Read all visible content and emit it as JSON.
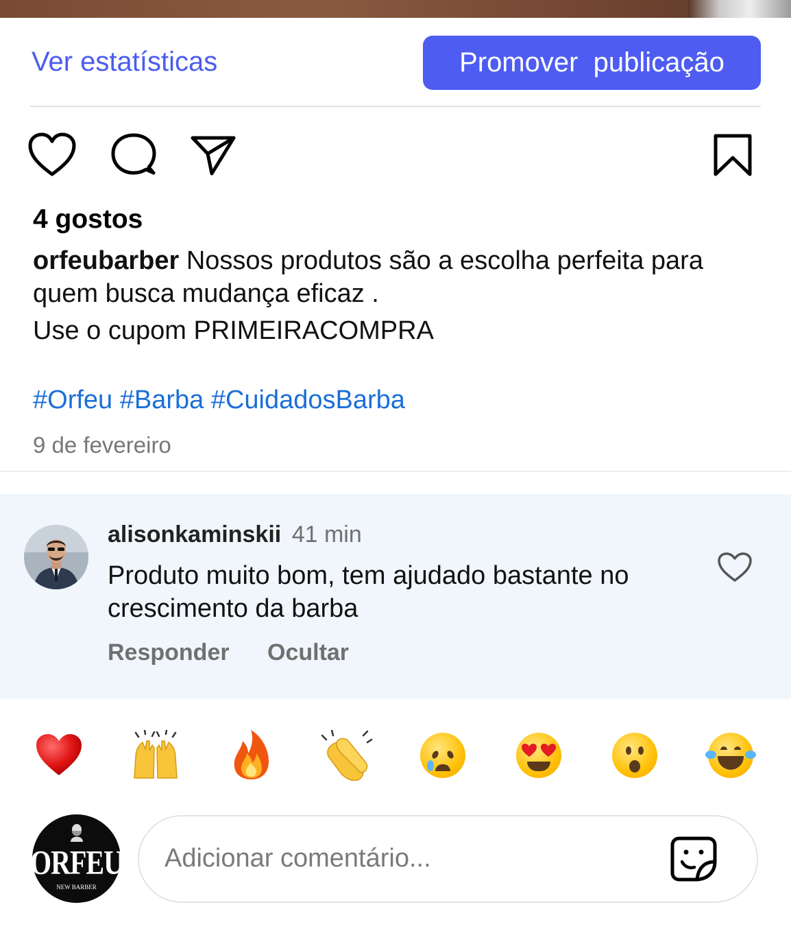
{
  "header": {
    "stats_link": "Ver estatísticas",
    "promote_button": "Promover  publicação"
  },
  "actions": {
    "like_icon": "heart-outline-icon",
    "comment_icon": "comment-bubble-icon",
    "share_icon": "paper-plane-icon",
    "save_icon": "bookmark-icon"
  },
  "post": {
    "likes": "4 gostos",
    "username": "orfeubarber",
    "caption_line1": " Nossos produtos são a escolha perfeita para quem busca mudança eficaz .",
    "caption_line2": "Use o cupom PRIMEIRACOMPRA",
    "hashtags": "#Orfeu #Barba #CuidadosBarba",
    "date": "9 de fevereiro"
  },
  "comment": {
    "username": "alisonkaminskii",
    "time": "41 min",
    "text": "Produto muito bom, tem ajudado bastante no crescimento da barba",
    "reply_label": "Responder",
    "hide_label": "Ocultar"
  },
  "reactions": [
    "❤️",
    "🙌",
    "🔥",
    "👏",
    "😢",
    "😍",
    "😮",
    "😂"
  ],
  "composer": {
    "avatar_brand": "ORFEU",
    "avatar_sub": "NEW BARBER",
    "placeholder": "Adicionar comentário..."
  },
  "colors": {
    "accent": "#4e5cf2",
    "link": "#4a5cf0",
    "hashtag": "#1b6fd8",
    "comment_bg": "#f0f6fb"
  }
}
